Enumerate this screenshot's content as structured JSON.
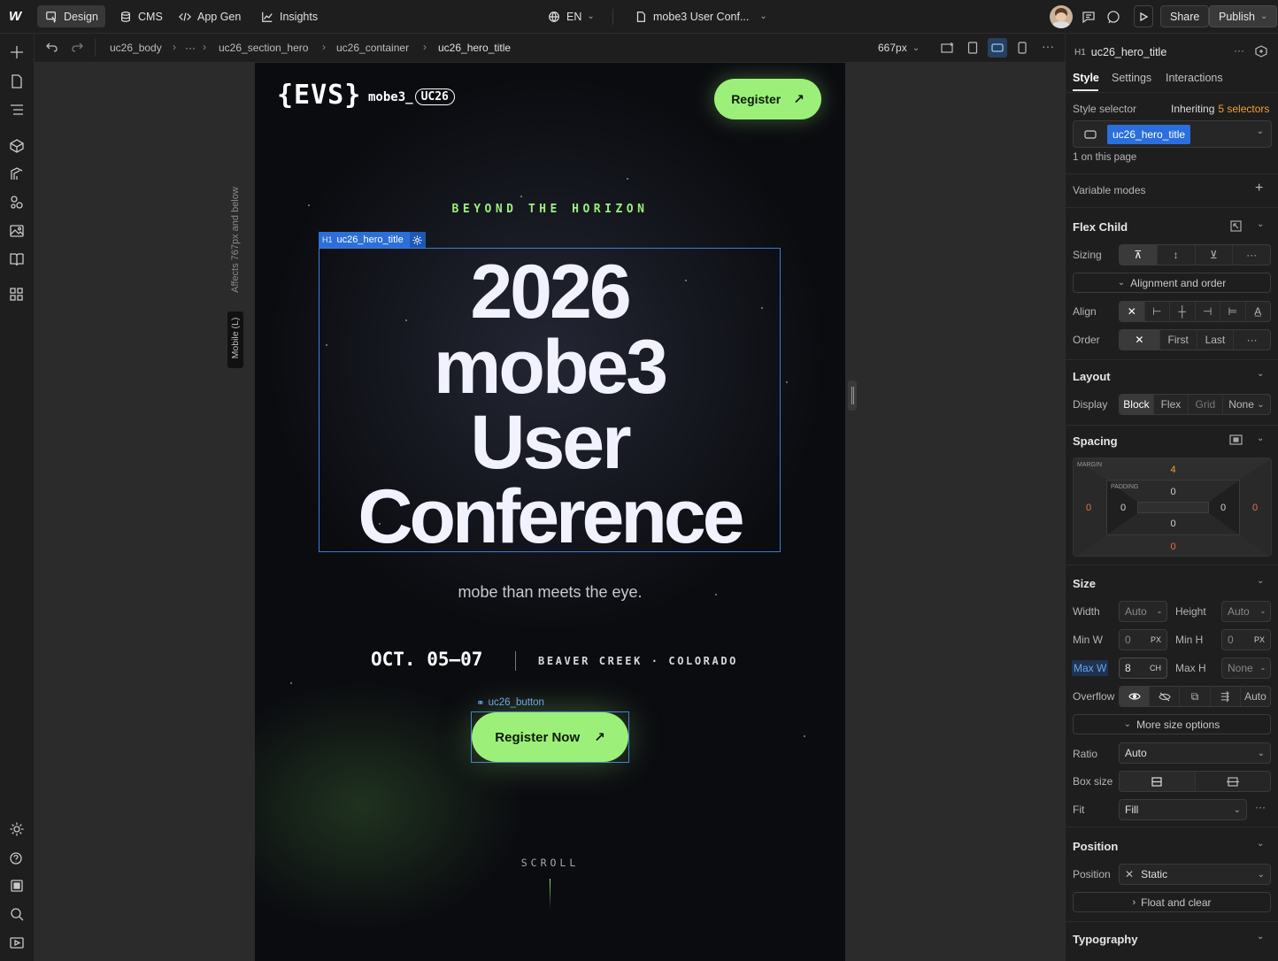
{
  "topbar": {
    "logo": "W",
    "tabs": [
      {
        "label": "Design",
        "icon": "cursor-icon",
        "active": true
      },
      {
        "label": "CMS",
        "icon": "database-icon"
      },
      {
        "label": "App Gen",
        "icon": "code-icon"
      },
      {
        "label": "Insights",
        "icon": "chart-icon"
      }
    ],
    "locale": "EN",
    "page_name": "mobe3 User Conf...",
    "share_label": "Share",
    "publish_label": "Publish"
  },
  "breadcrumb": {
    "items": [
      "uc26_body",
      "···",
      "uc26_section_hero",
      "uc26_container",
      "uc26_hero_title"
    ],
    "width_value": "667px"
  },
  "canvas": {
    "breakpoint_note": "Affects 767px and below",
    "breakpoint_tab": "Mobile (L)",
    "selection_label": "uc26_hero_title",
    "selection_tag": "H1",
    "button_selection_label": "uc26_button"
  },
  "site": {
    "logo_text": "{EVS}",
    "brand": "mobe3_",
    "brand_badge": "UC26",
    "register_label": "Register",
    "eyebrow": "BEYOND THE HORIZON",
    "title_lines": [
      "2026",
      "mobe3",
      "User",
      "Conference"
    ],
    "subtitle": "mobe than meets the eye.",
    "date": "OCT. 05–07",
    "location": "BEAVER CREEK · COLORADO",
    "cta_label": "Register Now",
    "scroll_label": "SCROLL",
    "accent_color": "#9cf07a"
  },
  "panel": {
    "element_tag": "H1",
    "element_name": "uc26_hero_title",
    "tabs": [
      "Style",
      "Settings",
      "Interactions"
    ],
    "active_tab": "Style",
    "style_selector_label": "Style selector",
    "inheriting_prefix": "Inheriting",
    "inheriting_count": "5 selectors",
    "selector_chip": "uc26_hero_title",
    "on_page": "1 on this page",
    "variable_modes": "Variable modes",
    "flex_child": {
      "title": "Flex Child",
      "sizing_label": "Sizing",
      "alignment_order": "Alignment and order",
      "align_label": "Align",
      "order_label": "Order",
      "order_options": [
        "First",
        "Last"
      ]
    },
    "layout": {
      "title": "Layout",
      "display_label": "Display",
      "display_options": [
        "Block",
        "Flex",
        "Grid",
        "None"
      ],
      "display_active": "Block"
    },
    "spacing": {
      "title": "Spacing",
      "margin_label": "MARGIN",
      "padding_label": "PADDING",
      "margin_top": "4",
      "margin_right": "0",
      "margin_bottom": "0",
      "margin_left": "0",
      "padding_top": "0",
      "padding_right": "0",
      "padding_bottom": "0",
      "padding_left": "0"
    },
    "size": {
      "title": "Size",
      "width_label": "Width",
      "width_value": "Auto",
      "height_label": "Height",
      "height_value": "Auto",
      "minw_label": "Min W",
      "minw_value": "0",
      "minw_unit": "PX",
      "minh_label": "Min H",
      "minh_value": "0",
      "minh_unit": "PX",
      "maxw_label": "Max W",
      "maxw_value": "8",
      "maxw_unit": "CH",
      "maxh_label": "Max H",
      "maxh_value": "None",
      "overflow_label": "Overflow",
      "overflow_auto": "Auto",
      "more_options": "More size options",
      "ratio_label": "Ratio",
      "ratio_value": "Auto",
      "boxsize_label": "Box size",
      "fit_label": "Fit",
      "fit_value": "Fill"
    },
    "position": {
      "title": "Position",
      "position_label": "Position",
      "position_value": "Static",
      "float_clear": "Float and clear"
    },
    "typography_title": "Typography"
  }
}
